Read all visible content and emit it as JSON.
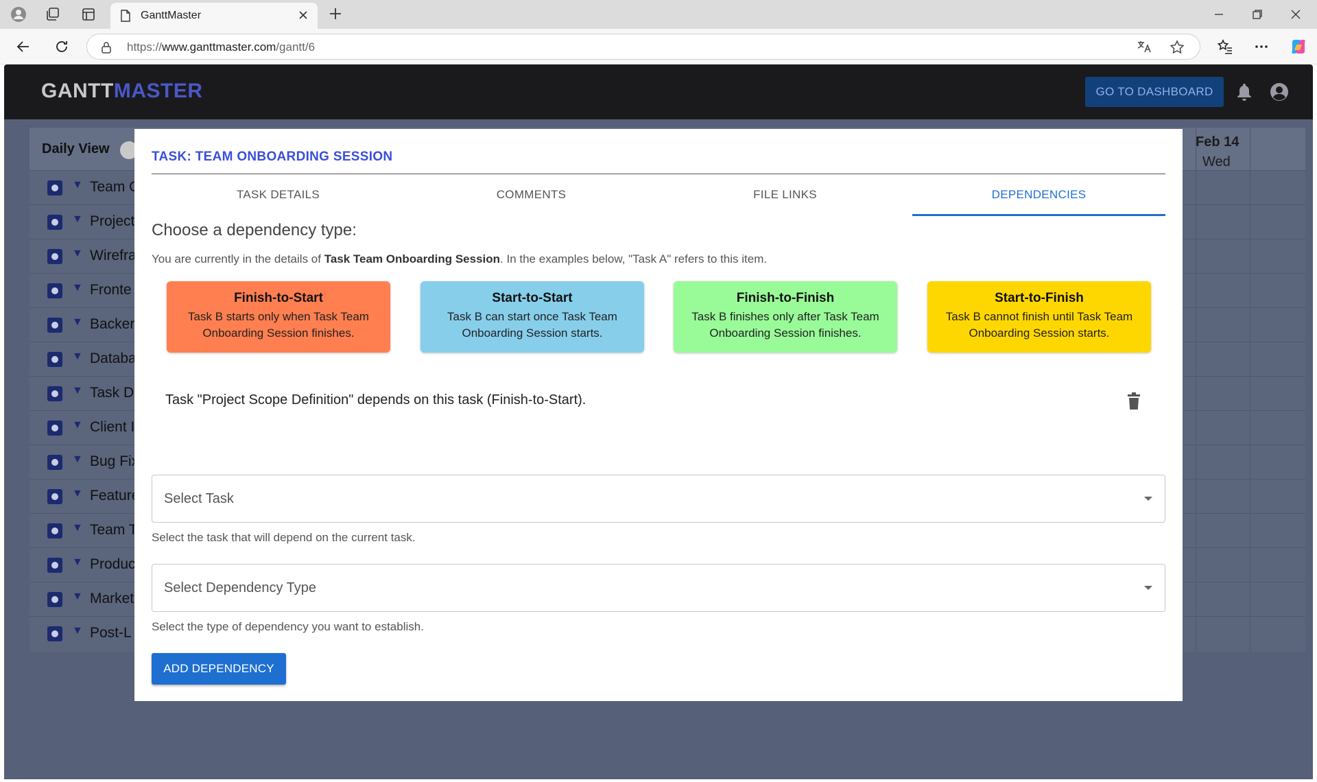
{
  "browser": {
    "tab_title": "GanttMaster",
    "url_prefix": "https://",
    "url_domain": "www.ganttmaster.com",
    "url_path": "/gantt/6"
  },
  "app": {
    "logo_part1": "GANTT",
    "logo_part2": "MASTER",
    "dashboard_button": "GO TO DASHBOARD"
  },
  "gantt": {
    "view_label": "Daily View",
    "date_day": "Feb 14",
    "date_weekday": "Wed",
    "rows": [
      "Team C",
      "Project",
      "Wirefra",
      "Fronte",
      "Backer",
      "Databa",
      "Task D",
      "Client I",
      "Bug Fix",
      "Feature",
      "Team T",
      "Produc",
      "Market",
      "Post-L"
    ]
  },
  "modal": {
    "title": "TASK: TEAM ONBOARDING SESSION",
    "tabs": [
      "TASK DETAILS",
      "COMMENTS",
      "FILE LINKS",
      "DEPENDENCIES"
    ],
    "active_tab": "DEPENDENCIES",
    "section_title": "Choose a dependency type:",
    "desc_before": "You are currently in the details of ",
    "desc_bold": "Task Team Onboarding Session",
    "desc_after": ". In the examples below, \"Task A\" refers to this item.",
    "cards": [
      {
        "title": "Finish-to-Start",
        "desc": "Task B starts only when Task Team Onboarding Session finishes.",
        "color": "#ff7f50"
      },
      {
        "title": "Start-to-Start",
        "desc": "Task B can start once Task Team Onboarding Session starts.",
        "color": "#87ceeb"
      },
      {
        "title": "Finish-to-Finish",
        "desc": "Task B finishes only after Task Team Onboarding Session finishes.",
        "color": "#98fb98"
      },
      {
        "title": "Start-to-Finish",
        "desc": "Task B cannot finish until Task Team Onboarding Session starts.",
        "color": "#ffd700"
      }
    ],
    "existing_dependency": "Task \"Project Scope Definition\" depends on this task (Finish-to-Start).",
    "select_task": {
      "label": "Select Task",
      "helper": "Select the task that will depend on the current task."
    },
    "select_type": {
      "label": "Select Dependency Type",
      "helper": "Select the type of dependency you want to establish."
    },
    "add_button": "ADD DEPENDENCY"
  },
  "colors": {
    "accent": "#1e6fd0",
    "title": "#3a4fd8",
    "header_bg": "#1a1a1c"
  }
}
